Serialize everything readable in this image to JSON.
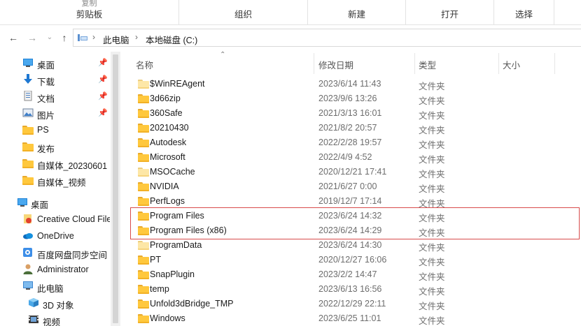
{
  "ribbon": {
    "groups": [
      {
        "label": "剪贴板",
        "peek": "复制"
      },
      {
        "label": "组织"
      },
      {
        "label": "新建"
      },
      {
        "label": "打开"
      },
      {
        "label": "选择"
      }
    ]
  },
  "address": {
    "crumbs": [
      "此电脑",
      "本地磁盘 (C:)"
    ]
  },
  "sidebar": {
    "items": [
      {
        "label": "桌面",
        "icon": "desktop-icon",
        "pinned": true
      },
      {
        "label": "下载",
        "icon": "download-icon",
        "pinned": true
      },
      {
        "label": "文档",
        "icon": "document-icon",
        "pinned": true
      },
      {
        "label": "图片",
        "icon": "picture-icon",
        "pinned": true
      },
      {
        "label": "PS",
        "icon": "folder-icon"
      },
      {
        "label": "发布",
        "icon": "folder-icon"
      },
      {
        "label": "自媒体_20230601",
        "icon": "folder-icon"
      },
      {
        "label": "自媒体_视频",
        "icon": "folder-icon"
      },
      {
        "label": "桌面",
        "icon": "desktop-icon"
      },
      {
        "label": "Creative Cloud Files",
        "icon": "creative-cloud-icon"
      },
      {
        "label": "OneDrive",
        "icon": "onedrive-icon"
      },
      {
        "label": "百度网盘同步空间",
        "icon": "baidu-netdisk-icon"
      },
      {
        "label": "Administrator",
        "icon": "user-icon"
      },
      {
        "label": "此电脑",
        "icon": "this-pc-icon"
      },
      {
        "label": "3D 对象",
        "icon": "3d-objects-icon"
      },
      {
        "label": "视频",
        "icon": "video-icon"
      }
    ]
  },
  "columns": {
    "name": "名称",
    "date": "修改日期",
    "type": "类型",
    "size": "大小"
  },
  "files": [
    {
      "name": "$WinREAgent",
      "date": "2023/6/14 11:43",
      "type": "文件夹",
      "pale": true
    },
    {
      "name": "3d66zip",
      "date": "2023/9/6 13:26",
      "type": "文件夹"
    },
    {
      "name": "360Safe",
      "date": "2021/3/13 16:01",
      "type": "文件夹"
    },
    {
      "name": "20210430",
      "date": "2021/8/2 20:57",
      "type": "文件夹"
    },
    {
      "name": "Autodesk",
      "date": "2022/2/28 19:57",
      "type": "文件夹"
    },
    {
      "name": "Microsoft",
      "date": "2022/4/9 4:52",
      "type": "文件夹"
    },
    {
      "name": "MSOCache",
      "date": "2020/12/21 17:41",
      "type": "文件夹",
      "pale": true
    },
    {
      "name": "NVIDIA",
      "date": "2021/6/27 0:00",
      "type": "文件夹"
    },
    {
      "name": "PerfLogs",
      "date": "2019/12/7 17:14",
      "type": "文件夹"
    },
    {
      "name": "Program Files",
      "date": "2023/6/24 14:32",
      "type": "文件夹"
    },
    {
      "name": "Program Files (x86)",
      "date": "2023/6/24 14:29",
      "type": "文件夹"
    },
    {
      "name": "ProgramData",
      "date": "2023/6/24 14:30",
      "type": "文件夹",
      "pale": true
    },
    {
      "name": "PT",
      "date": "2020/12/27 16:06",
      "type": "文件夹"
    },
    {
      "name": "SnapPlugin",
      "date": "2023/2/2 14:47",
      "type": "文件夹"
    },
    {
      "name": "temp",
      "date": "2023/6/13 16:56",
      "type": "文件夹"
    },
    {
      "name": "Unfold3dBridge_TMP",
      "date": "2022/12/29 22:11",
      "type": "文件夹"
    },
    {
      "name": "Windows",
      "date": "2023/6/25 11:01",
      "type": "文件夹"
    }
  ],
  "colors": {
    "highlight": "#d84b4b",
    "folder": "#ffc83d",
    "accent": "#0067c0"
  }
}
